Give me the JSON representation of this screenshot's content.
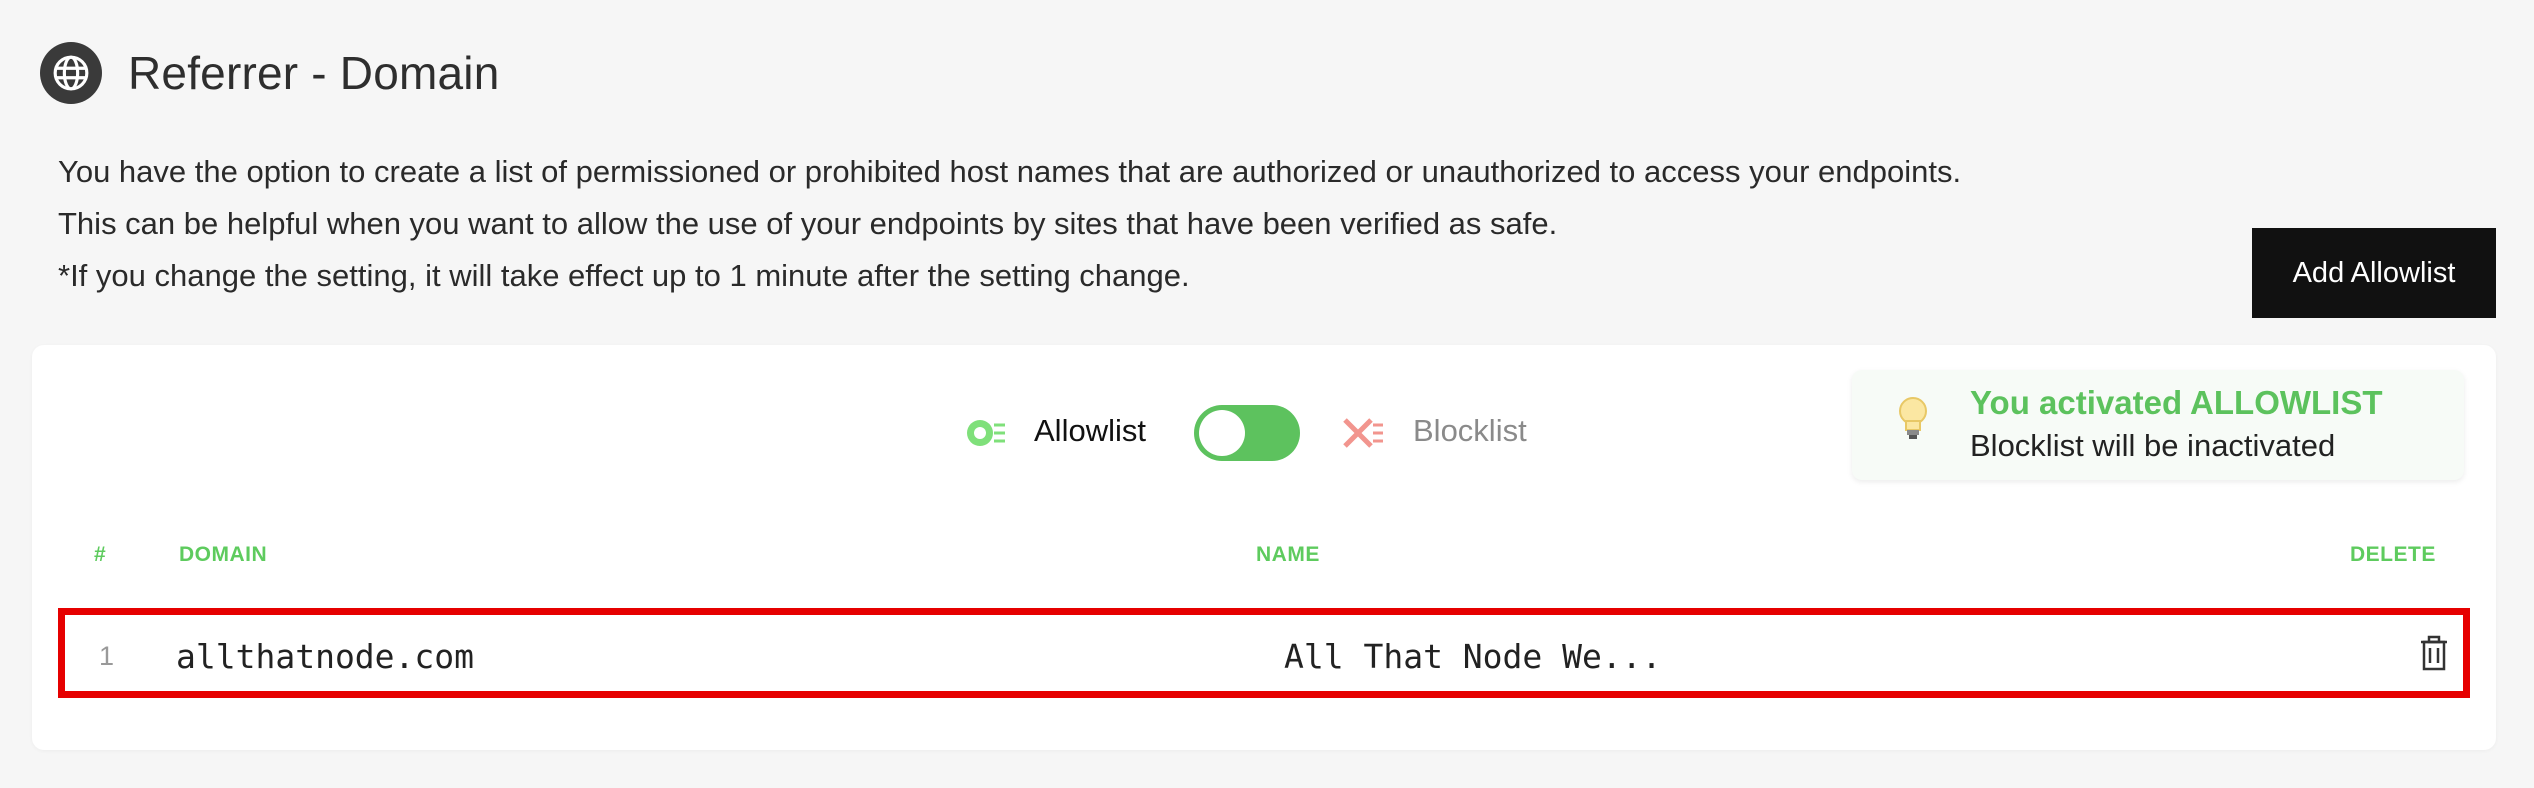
{
  "header": {
    "title": "Referrer - Domain",
    "icon": "globe-icon"
  },
  "description": {
    "line1": "You have the option to create a list of permissioned or prohibited host names that are authorized or unauthorized to access your endpoints.",
    "line2": "This can be helpful when you want to allow the use of your endpoints by sites that have been verified as safe.",
    "line3": "*If you change the setting, it will take effect up to 1 minute after the setting change."
  },
  "add_button": {
    "label": "Add Allowlist"
  },
  "toggle": {
    "allow_label": "Allowlist",
    "block_label": "Blocklist",
    "state": "allowlist",
    "active_color": "#5dc25e"
  },
  "notice": {
    "title": "You activated ALLOWLIST",
    "subtitle": "Blocklist will be inactivated",
    "icon": "lightbulb-icon"
  },
  "table": {
    "headers": {
      "num": "#",
      "domain": "DOMAIN",
      "name": "NAME",
      "delete": "DELETE"
    },
    "rows": [
      {
        "num": "1",
        "domain": "allthatnode.com",
        "name": "All That Node We...",
        "delete_icon": "trash-icon"
      }
    ]
  },
  "colors": {
    "accent": "#5cc25d",
    "highlight_border": "#e60000",
    "button_bg": "#111111"
  }
}
